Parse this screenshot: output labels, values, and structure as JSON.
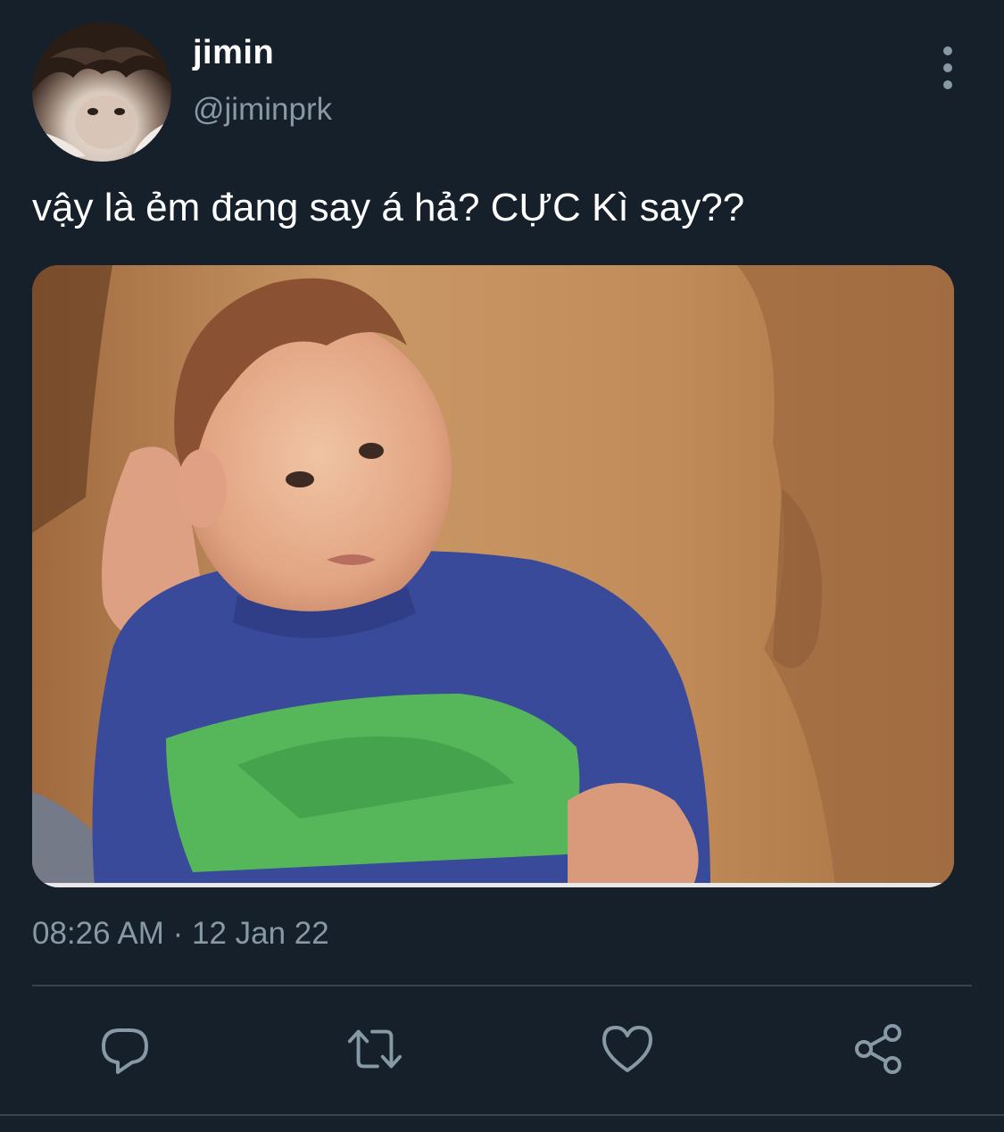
{
  "tweet": {
    "author": {
      "display_name": "jimin",
      "handle": "@jiminprk",
      "avatar": "profile-photo"
    },
    "text": "vậy là ẻm đang say á hả? CỰC Kì say??",
    "media": {
      "kind": "photo"
    },
    "timestamp": "08:26 AM · 12 Jan 22",
    "actions": [
      {
        "name": "reply",
        "icon": "reply-icon"
      },
      {
        "name": "retweet",
        "icon": "retweet-icon"
      },
      {
        "name": "like",
        "icon": "heart-icon"
      },
      {
        "name": "share",
        "icon": "share-icon"
      }
    ]
  },
  "colors": {
    "background": "#15202b",
    "secondary_text": "#8899a6",
    "divider": "#38444d",
    "primary_text": "#ffffff"
  }
}
